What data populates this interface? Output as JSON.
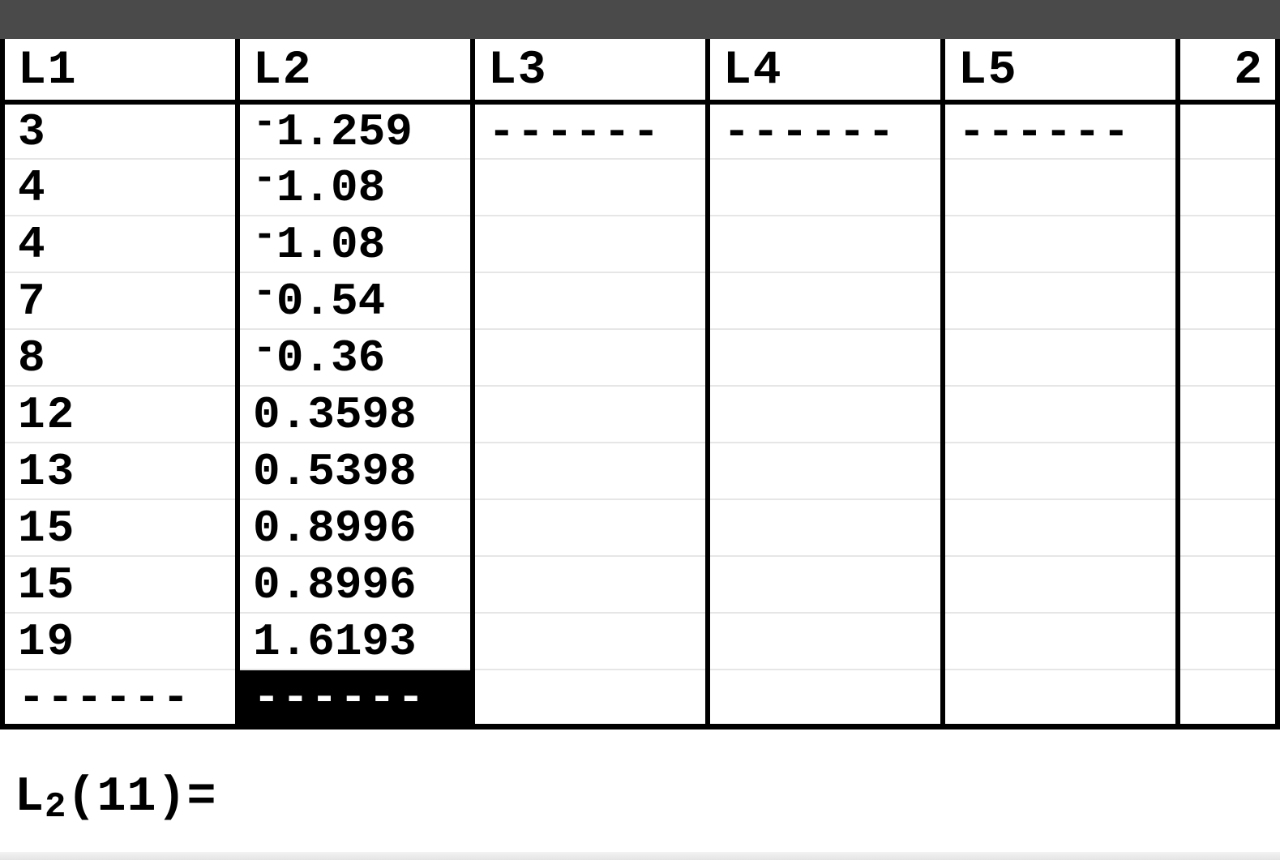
{
  "columns": {
    "headers": [
      "L1",
      "L2",
      "L3",
      "L4",
      "L5"
    ],
    "indicator": "2"
  },
  "rows": [
    {
      "L1": "3",
      "L2": {
        "neg": true,
        "val": "1.259"
      },
      "L3": "------",
      "L4": "------",
      "L5": "------"
    },
    {
      "L1": "4",
      "L2": {
        "neg": true,
        "val": "1.08"
      }
    },
    {
      "L1": "4",
      "L2": {
        "neg": true,
        "val": "1.08"
      }
    },
    {
      "L1": "7",
      "L2": {
        "neg": true,
        "val": "0.54"
      }
    },
    {
      "L1": "8",
      "L2": {
        "neg": true,
        "val": "0.36"
      }
    },
    {
      "L1": "12",
      "L2": {
        "neg": false,
        "val": "0.3598"
      }
    },
    {
      "L1": "13",
      "L2": {
        "neg": false,
        "val": "0.5398"
      }
    },
    {
      "L1": "15",
      "L2": {
        "neg": false,
        "val": "0.8996"
      }
    },
    {
      "L1": "15",
      "L2": {
        "neg": false,
        "val": "0.8996"
      }
    },
    {
      "L1": "19",
      "L2": {
        "neg": false,
        "val": "1.6193"
      }
    }
  ],
  "end_markers": {
    "L1": "------",
    "L2": "------"
  },
  "cursor": {
    "col": "L2",
    "row_index": 10
  },
  "entry": {
    "list": "L2",
    "index": "11",
    "value": ""
  },
  "glyphs": {
    "neg_sign": "-"
  }
}
